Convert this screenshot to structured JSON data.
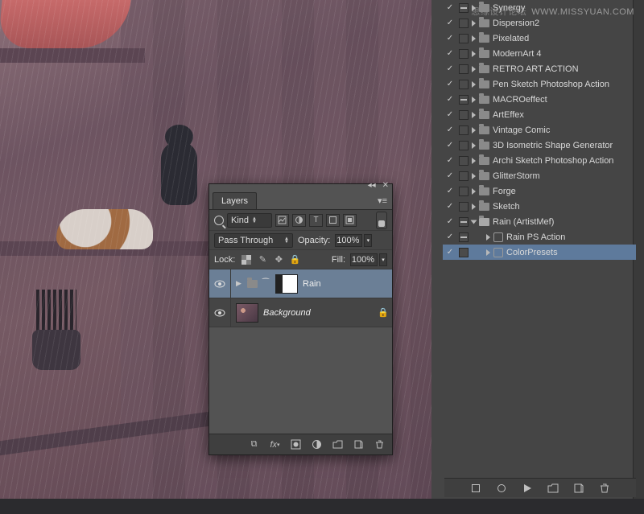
{
  "watermark": {
    "cn": "思缘设计论坛",
    "url": "WWW.MISSYUAN.COM"
  },
  "actions": {
    "items": [
      {
        "label": "Synergy",
        "checked": true,
        "stop": "dash",
        "type": "folder"
      },
      {
        "label": "Dispersion2",
        "checked": true,
        "stop": "box",
        "type": "folder"
      },
      {
        "label": "Pixelated",
        "checked": true,
        "stop": "box",
        "type": "folder"
      },
      {
        "label": "ModernArt 4",
        "checked": true,
        "stop": "box",
        "type": "folder"
      },
      {
        "label": "RETRO ART ACTION",
        "checked": true,
        "stop": "box",
        "type": "folder"
      },
      {
        "label": "Pen Sketch Photoshop Action",
        "checked": true,
        "stop": "box",
        "type": "folder"
      },
      {
        "label": "MACROeffect",
        "checked": true,
        "stop": "dash",
        "type": "folder"
      },
      {
        "label": "ArtEffex",
        "checked": true,
        "stop": "box",
        "type": "folder"
      },
      {
        "label": "Vintage Comic",
        "checked": true,
        "stop": "box",
        "type": "folder"
      },
      {
        "label": "3D Isometric Shape Generator",
        "checked": true,
        "stop": "box",
        "type": "folder"
      },
      {
        "label": "Archi Sketch Photoshop Action",
        "checked": true,
        "stop": "box",
        "type": "folder"
      },
      {
        "label": "GlitterStorm",
        "checked": true,
        "stop": "box",
        "type": "folder"
      },
      {
        "label": "Forge",
        "checked": true,
        "stop": "box",
        "type": "folder"
      },
      {
        "label": "Sketch",
        "checked": true,
        "stop": "box",
        "type": "folder"
      },
      {
        "label": "Rain (ArtistMef)",
        "checked": true,
        "stop": "dash",
        "type": "folder-open"
      },
      {
        "label": "Rain PS Action",
        "checked": true,
        "stop": "dash",
        "type": "action",
        "indent": 1
      },
      {
        "label": "ColorPresets",
        "checked": true,
        "stop": "box",
        "type": "action",
        "indent": 1,
        "selected": true
      }
    ],
    "footer_icons": [
      "stop",
      "record",
      "play",
      "new-set",
      "new-action",
      "trash"
    ]
  },
  "layers": {
    "tab": "Layers",
    "filter": {
      "kind_label": "Kind",
      "type_icons": [
        "image",
        "adjust",
        "type",
        "shape",
        "smart"
      ]
    },
    "blend_mode": "Pass Through",
    "opacity_label": "Opacity:",
    "opacity_value": "100%",
    "lock_label": "Lock:",
    "fill_label": "Fill:",
    "fill_value": "100%",
    "rows": [
      {
        "name": "Rain",
        "kind": "group-mask",
        "visible": true,
        "selected": true
      },
      {
        "name": "Background",
        "kind": "image",
        "visible": true,
        "locked": true,
        "italic": true
      }
    ],
    "footer_icons": [
      "link",
      "fx",
      "mask",
      "adjust",
      "group",
      "new",
      "trash"
    ]
  }
}
